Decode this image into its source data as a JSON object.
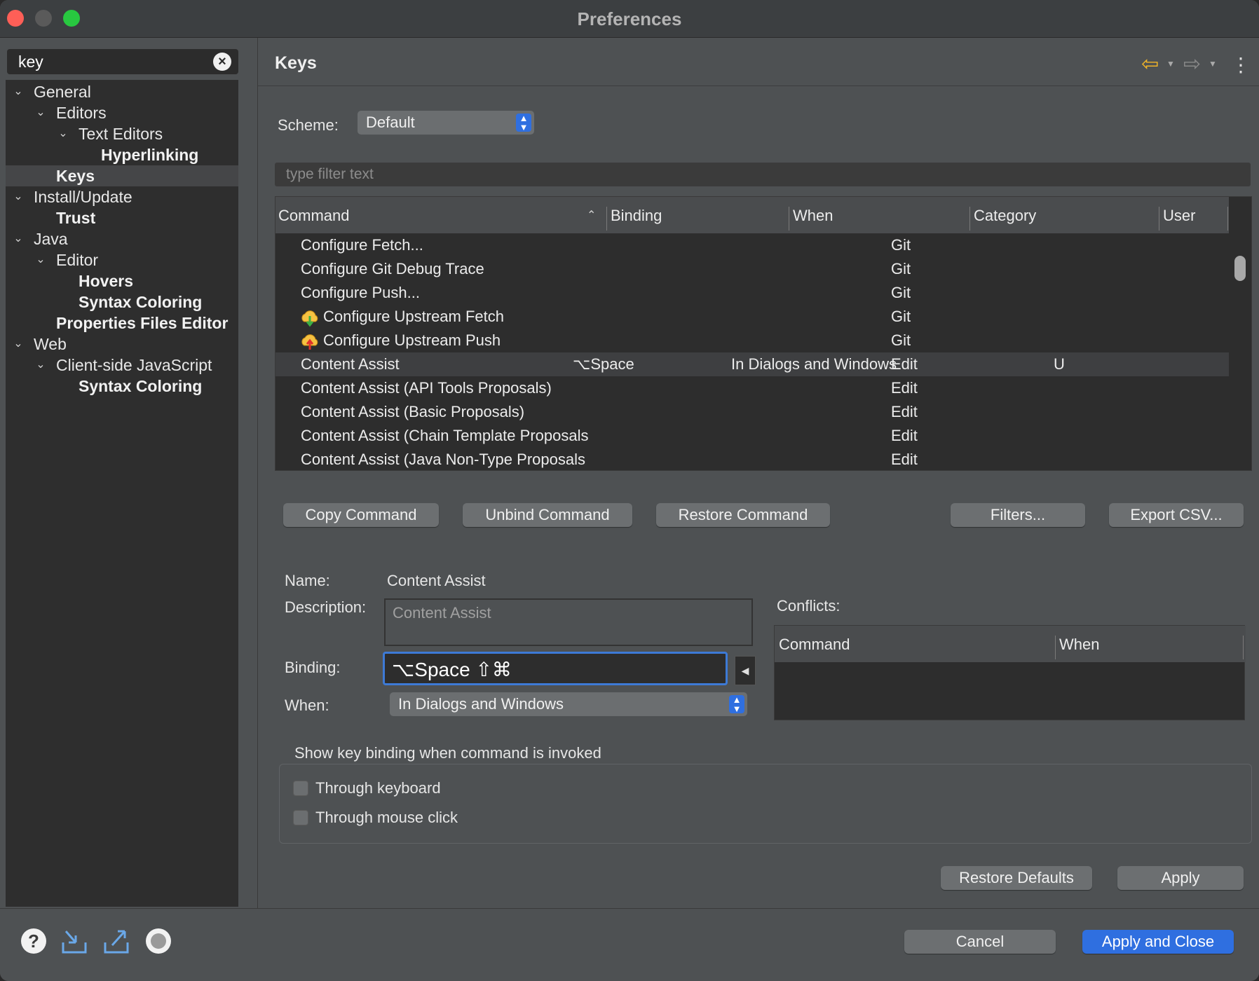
{
  "window": {
    "title": "Preferences"
  },
  "search": {
    "value": "key"
  },
  "tree": [
    {
      "label": "General",
      "indent": 0,
      "chevron": true,
      "bold": false
    },
    {
      "label": "Editors",
      "indent": 1,
      "chevron": true,
      "bold": false
    },
    {
      "label": "Text Editors",
      "indent": 2,
      "chevron": true,
      "bold": false
    },
    {
      "label": "Hyperlinking",
      "indent": 3,
      "chevron": false,
      "bold": true
    },
    {
      "label": "Keys",
      "indent": 1,
      "chevron": false,
      "bold": true,
      "selected": true
    },
    {
      "label": "Install/Update",
      "indent": 0,
      "chevron": true,
      "bold": false
    },
    {
      "label": "Trust",
      "indent": 1,
      "chevron": false,
      "bold": true
    },
    {
      "label": "Java",
      "indent": 0,
      "chevron": true,
      "bold": false
    },
    {
      "label": "Editor",
      "indent": 1,
      "chevron": true,
      "bold": false
    },
    {
      "label": "Hovers",
      "indent": 2,
      "chevron": false,
      "bold": true
    },
    {
      "label": "Syntax Coloring",
      "indent": 2,
      "chevron": false,
      "bold": true
    },
    {
      "label": "Properties Files Editor",
      "indent": 1,
      "chevron": false,
      "bold": true
    },
    {
      "label": "Web",
      "indent": 0,
      "chevron": true,
      "bold": false
    },
    {
      "label": "Client-side JavaScript",
      "indent": 1,
      "chevron": true,
      "bold": false
    },
    {
      "label": "Syntax Coloring",
      "indent": 2,
      "chevron": false,
      "bold": true
    }
  ],
  "page": {
    "title": "Keys"
  },
  "scheme": {
    "label": "Scheme:",
    "value": "Default"
  },
  "filter": {
    "placeholder": "type filter text"
  },
  "table": {
    "headers": {
      "command": "Command",
      "binding": "Binding",
      "when": "When",
      "category": "Category",
      "user": "User"
    },
    "rows": [
      {
        "command": "Configure Fetch...",
        "binding": "",
        "when": "",
        "category": "Git",
        "user": "",
        "icon": ""
      },
      {
        "command": "Configure Git Debug Trace",
        "binding": "",
        "when": "",
        "category": "Git",
        "user": "",
        "icon": ""
      },
      {
        "command": "Configure Push...",
        "binding": "",
        "when": "",
        "category": "Git",
        "user": "",
        "icon": ""
      },
      {
        "command": "Configure Upstream Fetch",
        "binding": "",
        "when": "",
        "category": "Git",
        "user": "",
        "icon": "upstream-fetch-icon"
      },
      {
        "command": "Configure Upstream Push",
        "binding": "",
        "when": "",
        "category": "Git",
        "user": "",
        "icon": "upstream-push-icon"
      },
      {
        "command": "Content Assist",
        "binding": "⌥Space",
        "when": "In Dialogs and Windows",
        "category": "Edit",
        "user": "U",
        "icon": "",
        "selected": true
      },
      {
        "command": "Content Assist (API Tools Proposals)",
        "binding": "",
        "when": "",
        "category": "Edit",
        "user": "",
        "icon": ""
      },
      {
        "command": "Content Assist (Basic Proposals)",
        "binding": "",
        "when": "",
        "category": "Edit",
        "user": "",
        "icon": ""
      },
      {
        "command": "Content Assist (Chain Template Proposals",
        "binding": "",
        "when": "",
        "category": "Edit",
        "user": "",
        "icon": ""
      },
      {
        "command": "Content Assist (Java Non-Type Proposals",
        "binding": "",
        "when": "",
        "category": "Edit",
        "user": "",
        "icon": ""
      }
    ]
  },
  "buttons": {
    "copy": "Copy Command",
    "unbind": "Unbind Command",
    "restore": "Restore Command",
    "filters": "Filters...",
    "export": "Export CSV...",
    "restore_defaults": "Restore Defaults",
    "apply": "Apply",
    "cancel": "Cancel",
    "apply_close": "Apply and Close"
  },
  "details": {
    "name_label": "Name:",
    "name_value": "Content Assist",
    "description_label": "Description:",
    "description_value": "Content Assist",
    "binding_label": "Binding:",
    "binding_value": "⌥Space ⇧⌘",
    "when_label": "When:",
    "when_value": "In Dialogs and Windows"
  },
  "conflicts": {
    "label": "Conflicts:",
    "headers": {
      "command": "Command",
      "when": "When"
    }
  },
  "show_binding": {
    "title": "Show key binding when command is invoked",
    "through_keyboard": "Through keyboard",
    "through_mouse": "Through mouse click",
    "keyboard_checked": false,
    "mouse_checked": false
  },
  "colors": {
    "accent": "#2f6fe0",
    "panel": "#4e5153",
    "dark": "#2d2d2d"
  }
}
